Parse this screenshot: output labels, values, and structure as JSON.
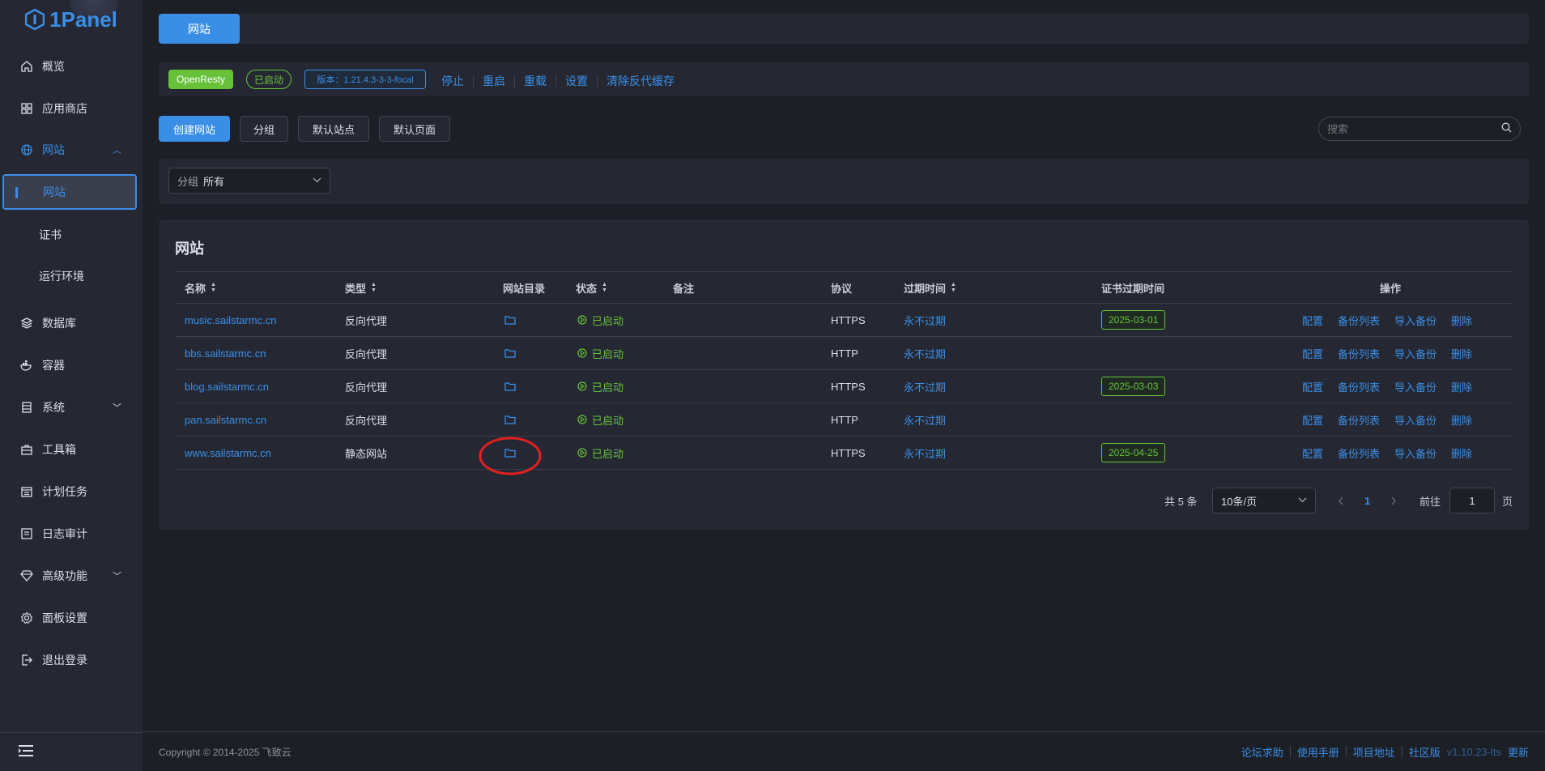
{
  "app": {
    "logo": "1Panel"
  },
  "sidebar": {
    "items": [
      {
        "label": "概览",
        "icon": "home-icon"
      },
      {
        "label": "应用商店",
        "icon": "grid-icon"
      },
      {
        "label": "网站",
        "icon": "globe-icon"
      },
      {
        "label": "数据库",
        "icon": "database-icon"
      },
      {
        "label": "容器",
        "icon": "docker-icon"
      },
      {
        "label": "系统",
        "icon": "system-icon"
      },
      {
        "label": "工具箱",
        "icon": "toolbox-icon"
      },
      {
        "label": "计划任务",
        "icon": "calendar-icon"
      },
      {
        "label": "日志审计",
        "icon": "log-icon"
      },
      {
        "label": "高级功能",
        "icon": "diamond-icon"
      },
      {
        "label": "面板设置",
        "icon": "gear-icon"
      },
      {
        "label": "退出登录",
        "icon": "logout-icon"
      }
    ],
    "subitems": [
      {
        "label": "网站"
      },
      {
        "label": "证书"
      },
      {
        "label": "运行环境"
      }
    ]
  },
  "topbar": {
    "tab": "网站"
  },
  "openresty": {
    "name": "OpenResty",
    "status": "已启动",
    "version": "版本：1.21.4.3-3-3-focal",
    "actions": [
      "停止",
      "重启",
      "重载",
      "设置",
      "清除反代缓存"
    ]
  },
  "toolbar": {
    "create": "创建网站",
    "group": "分组",
    "default_site": "默认站点",
    "default_page": "默认页面",
    "search_placeholder": "搜索"
  },
  "filter": {
    "label": "分组",
    "value": "所有"
  },
  "table": {
    "title": "网站",
    "headers": {
      "name": "名称",
      "type": "类型",
      "dir": "网站目录",
      "status": "状态",
      "remark": "备注",
      "protocol": "协议",
      "expire": "过期时间",
      "cert_expire": "证书过期时间",
      "ops": "操作"
    },
    "rows": [
      {
        "name": "music.sailstarmc.cn",
        "type": "反向代理",
        "status": "已启动",
        "protocol": "HTTPS",
        "expire": "永不过期",
        "cert": "2025-03-01"
      },
      {
        "name": "bbs.sailstarmc.cn",
        "type": "反向代理",
        "status": "已启动",
        "protocol": "HTTP",
        "expire": "永不过期",
        "cert": ""
      },
      {
        "name": "blog.sailstarmc.cn",
        "type": "反向代理",
        "status": "已启动",
        "protocol": "HTTPS",
        "expire": "永不过期",
        "cert": "2025-03-03"
      },
      {
        "name": "pan.sailstarmc.cn",
        "type": "反向代理",
        "status": "已启动",
        "protocol": "HTTP",
        "expire": "永不过期",
        "cert": ""
      },
      {
        "name": "www.sailstarmc.cn",
        "type": "静态网站",
        "status": "已启动",
        "protocol": "HTTPS",
        "expire": "永不过期",
        "cert": "2025-04-25"
      }
    ],
    "ops": [
      "配置",
      "备份列表",
      "导入备份",
      "删除"
    ]
  },
  "pagination": {
    "total": "共 5 条",
    "page_size": "10条/页",
    "current": "1",
    "goto_label": "前往",
    "goto_value": "1",
    "page_suffix": "页"
  },
  "footer": {
    "copyright": "Copyright © 2014-2025 飞致云",
    "links": [
      "论坛求助",
      "使用手册",
      "项目地址",
      "社区版"
    ],
    "version": "v1.10.23-lts",
    "update": "更新"
  },
  "colors": {
    "accent": "#3a8ee6",
    "success": "#67c23a",
    "annotation": "#e02020"
  }
}
